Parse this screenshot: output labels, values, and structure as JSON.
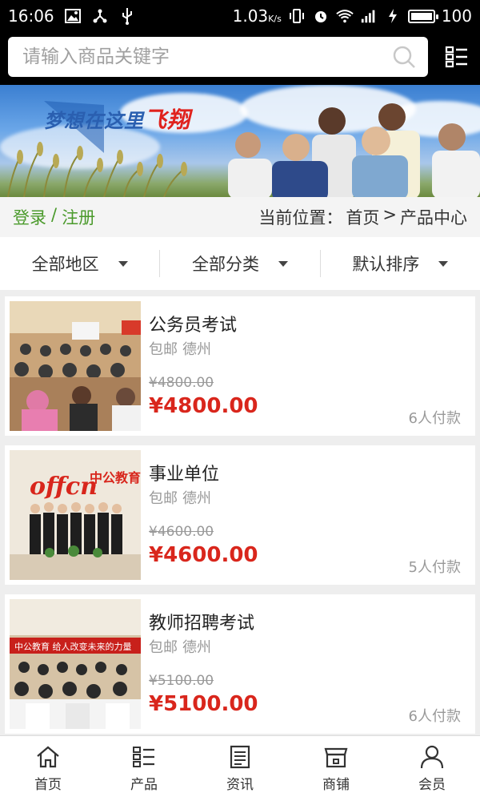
{
  "statusbar": {
    "time": "16:06",
    "speed": "1.03",
    "speed_unit": "K/s",
    "battery": "100"
  },
  "search": {
    "placeholder": "请输入商品关键字"
  },
  "banner": {
    "slogan_main": "梦想在这里",
    "slogan_accent": "飞翔"
  },
  "auth": {
    "login": "登录",
    "sep": "/",
    "register": "注册"
  },
  "breadcrumb": {
    "prefix": "当前位置：",
    "home": "首页",
    "sep": ">",
    "current": "产品中心"
  },
  "filters": [
    {
      "label": "全部地区"
    },
    {
      "label": "全部分类"
    },
    {
      "label": "默认排序"
    }
  ],
  "products": [
    {
      "name": "公务员考试",
      "shipping": "包邮",
      "city": "德州",
      "old_price": "¥4800.00",
      "price": "¥4800.00",
      "paid": "6人付款"
    },
    {
      "name": "事业单位",
      "shipping": "包邮",
      "city": "德州",
      "old_price": "¥4600.00",
      "price": "¥4600.00",
      "paid": "5人付款"
    },
    {
      "name": "教师招聘考试",
      "shipping": "包邮",
      "city": "德州",
      "old_price": "¥5100.00",
      "price": "¥5100.00",
      "paid": "6人付款"
    }
  ],
  "bottom_nav": [
    {
      "label": "首页",
      "icon": "home-icon"
    },
    {
      "label": "产品",
      "icon": "list-icon"
    },
    {
      "label": "资讯",
      "icon": "news-icon"
    },
    {
      "label": "商铺",
      "icon": "store-icon"
    },
    {
      "label": "会员",
      "icon": "user-icon"
    }
  ],
  "colors": {
    "accent_green": "#4a9a2b",
    "price_red": "#d9261c"
  }
}
